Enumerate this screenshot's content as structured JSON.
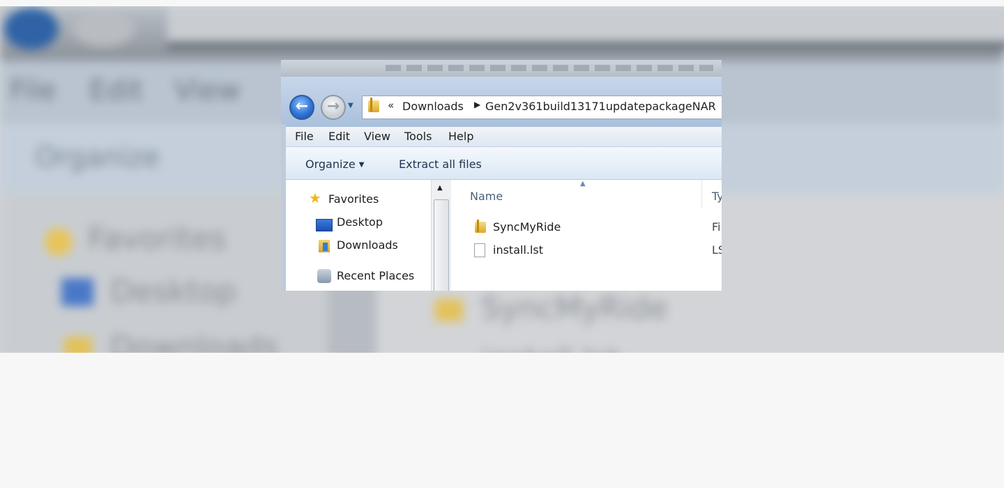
{
  "window": {
    "address": {
      "overflow_chevron": "«",
      "segments": [
        "Downloads",
        "Gen2v361build13171updatepackageNAR"
      ]
    },
    "menu": [
      "File",
      "Edit",
      "View",
      "Tools",
      "Help"
    ],
    "commands": {
      "organize": "Organize",
      "extract_all": "Extract all files"
    },
    "nav_pane": {
      "items": [
        {
          "label": "Favorites",
          "icon": "star-icon"
        },
        {
          "label": "Desktop",
          "icon": "desktop-icon"
        },
        {
          "label": "Downloads",
          "icon": "downloads-folder-icon"
        },
        {
          "label": "Recent Places",
          "icon": "recent-places-icon"
        }
      ]
    },
    "columns": {
      "name": "Name",
      "type": "Ty"
    },
    "files": [
      {
        "name": "SyncMyRide",
        "type": "Fi",
        "icon": "folder-icon"
      },
      {
        "name": "install.lst",
        "type": "LS",
        "icon": "file-icon"
      }
    ]
  },
  "background": {
    "menu": [
      "File",
      "Edit",
      "View"
    ],
    "organize": "Organize",
    "nav": [
      "Favorites",
      "Desktop",
      "Downloads"
    ],
    "content": [
      "SyncMyRide",
      "install.lst"
    ]
  }
}
